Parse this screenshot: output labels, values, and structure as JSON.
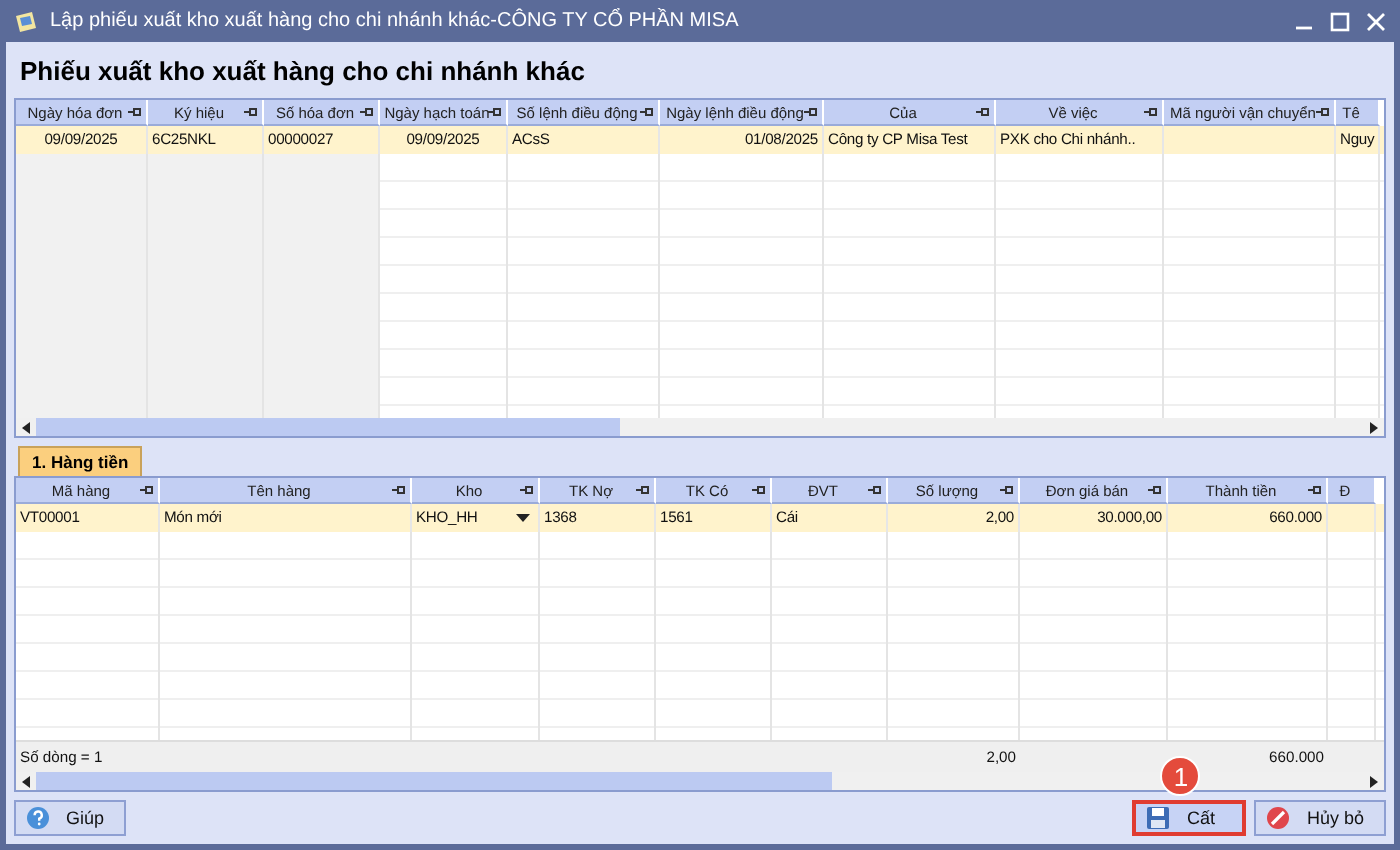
{
  "window": {
    "title": "Lập phiếu xuất kho xuất hàng cho chi nhánh khác-CÔNG TY CỔ PHẦN MISA"
  },
  "heading": "Phiếu xuất kho xuất hàng cho chi nhánh khác",
  "top_table": {
    "columns": [
      "Ngày hóa đơn",
      "Ký hiệu",
      "Số hóa đơn",
      "Ngày hạch toán",
      "Số lệnh điều động",
      "Ngày lệnh điều động",
      "Của",
      "Về việc",
      "Mã người vận chuyển",
      "Tê"
    ],
    "rows": [
      {
        "selected": true,
        "cells": [
          "09/09/2025",
          "6C25NKL",
          "00000027",
          "09/09/2025",
          "ACsS",
          "01/08/2025",
          "Công ty CP Misa Test",
          "PXK cho Chi nhánh..",
          "",
          "Nguy"
        ]
      }
    ]
  },
  "tab": {
    "label": "1. Hàng tiền",
    "selected": true
  },
  "bottom_table": {
    "columns": [
      "Mã hàng",
      "Tên hàng",
      "Kho",
      "TK Nợ",
      "TK Có",
      "ĐVT",
      "Số lượng",
      "Đơn giá bán",
      "Thành tiền",
      "Đ"
    ],
    "rows": [
      {
        "selected": true,
        "cells": [
          "VT00001",
          "Món mới",
          "KHO_HH",
          "1368",
          "1561",
          "Cái",
          "2,00",
          "30.000,00",
          "660.000",
          ""
        ]
      }
    ],
    "footer": {
      "row_count": "Số dòng = 1",
      "quantity_total": "2,00",
      "amount_total": "660.000"
    }
  },
  "buttons": [
    {
      "label": "Giúp",
      "kind": "help",
      "highlighted": false
    },
    {
      "label": "Cất",
      "kind": "save",
      "highlighted": true
    },
    {
      "label": "Hủy bỏ",
      "kind": "cancel",
      "highlighted": false
    }
  ],
  "step_badge": "1"
}
